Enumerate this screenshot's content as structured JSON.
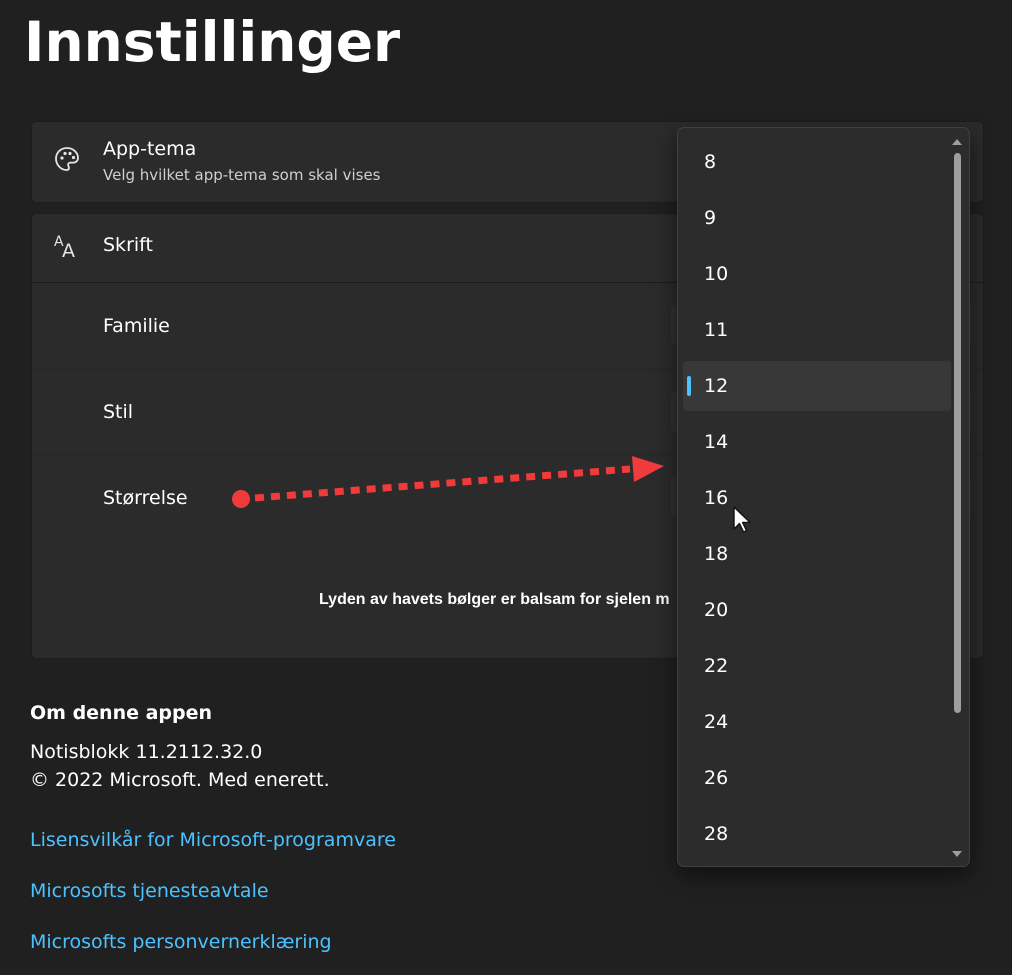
{
  "page": {
    "title": "Innstillinger"
  },
  "app_theme": {
    "title": "App-tema",
    "subtitle": "Velg hvilket app-tema som skal vises",
    "icon": "palette-icon"
  },
  "font": {
    "title": "Skrift",
    "icon": "font-icon",
    "rows": [
      {
        "label": "Familie"
      },
      {
        "label": "Stil"
      },
      {
        "label": "Størrelse"
      }
    ],
    "preview_text": "Lyden av havets bølger er balsam for sjelen m"
  },
  "about": {
    "heading": "Om denne appen",
    "version": "Notisblokk 11.2112.32.0",
    "copyright": "© 2022 Microsoft. Med enerett."
  },
  "links": [
    {
      "label": "Lisensvilkår for Microsoft-programvare"
    },
    {
      "label": "Microsofts tjenesteavtale"
    },
    {
      "label": "Microsofts personvernerklæring"
    }
  ],
  "size_dropdown": {
    "options": [
      "8",
      "9",
      "10",
      "11",
      "12",
      "14",
      "16",
      "18",
      "20",
      "22",
      "24",
      "26",
      "28"
    ],
    "selected": "12",
    "accent_color": "#4cc2ff"
  },
  "annotation": {
    "color": "#ef3b3b"
  }
}
